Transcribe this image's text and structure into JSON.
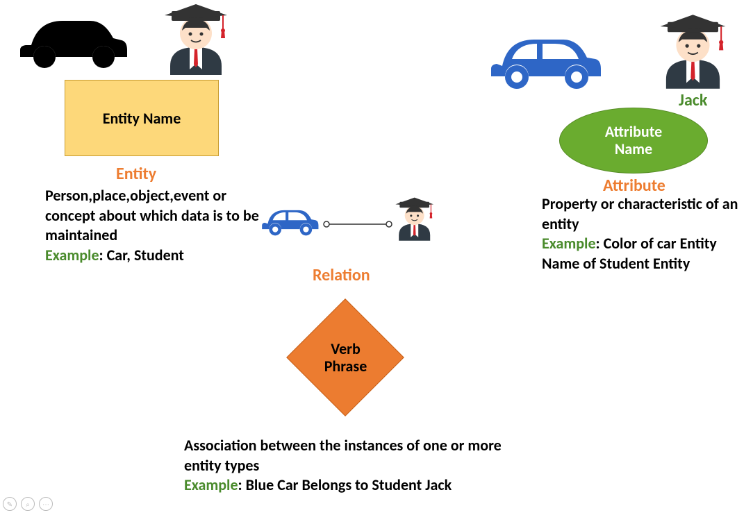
{
  "entity": {
    "shape_label": "Entity Name",
    "title": "Entity",
    "description": "Person,place,object,event or concept about which data is to be maintained",
    "example_key": "Example",
    "example_value": ": Car, Student"
  },
  "attribute": {
    "jack_label": "Jack",
    "shape_label": "Attribute Name",
    "title": "Attribute",
    "description": "Property or characteristic of an entity",
    "example_key": "Example",
    "example_value": ": Color of car Entity Name of Student Entity"
  },
  "relation": {
    "title": "Relation",
    "shape_label": "Verb Phrase",
    "description": "Association between the instances of one or more entity types",
    "example_key": "Example",
    "example_value": ": Blue Car Belongs to Student Jack"
  }
}
